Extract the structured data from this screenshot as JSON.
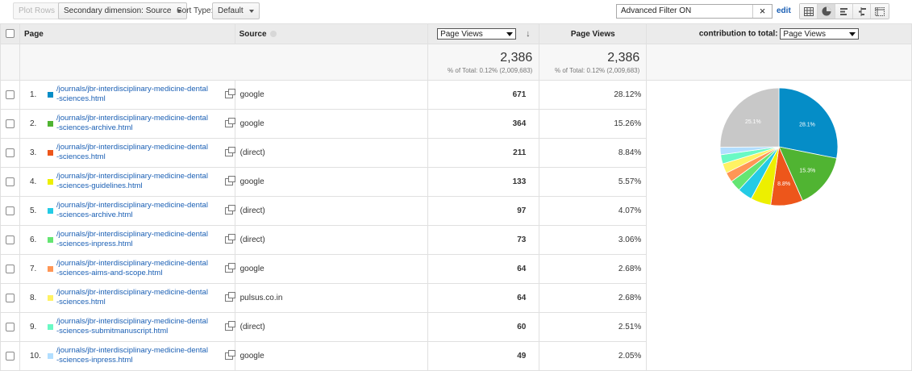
{
  "toolbar": {
    "plot_rows": "Plot Rows",
    "secondary_dimension": "Secondary dimension: Source",
    "sort_type_label": "Sort Type:",
    "sort_type_value": "Default",
    "filter_text": "Advanced Filter ON",
    "filter_clear": "×",
    "edit": "edit",
    "views": [
      "table-view-icon",
      "pie-view-icon",
      "performance-view-icon",
      "comparison-view-icon",
      "pivot-view-icon"
    ],
    "active_view": "pie-view-icon"
  },
  "columns": {
    "page": "Page",
    "source": "Source",
    "metric_select": "Page Views",
    "page_views": "Page Views",
    "contribution_label": "contribution to total:",
    "contribution_select": "Page Views"
  },
  "summary": {
    "page_views_1": "2,386",
    "page_views_1_sub": "% of Total: 0.12% (2,009,683)",
    "page_views_2": "2,386",
    "page_views_2_sub": "% of Total: 0.12% (2,009,683)"
  },
  "rows": [
    {
      "idx": "1.",
      "color": "#058dc7",
      "page_l1": "/journals/jbr-interdisciplinary-medicine-dental",
      "page_l2": "-sciences.html",
      "source": "google",
      "views": "671",
      "pct": "28.12%"
    },
    {
      "idx": "2.",
      "color": "#50b432",
      "page_l1": "/journals/jbr-interdisciplinary-medicine-dental",
      "page_l2": "-sciences-archive.html",
      "source": "google",
      "views": "364",
      "pct": "15.26%"
    },
    {
      "idx": "3.",
      "color": "#ed561b",
      "page_l1": "/journals/jbr-interdisciplinary-medicine-dental",
      "page_l2": "-sciences.html",
      "source": "(direct)",
      "views": "211",
      "pct": "8.84%"
    },
    {
      "idx": "4.",
      "color": "#edef00",
      "page_l1": "/journals/jbr-interdisciplinary-medicine-dental",
      "page_l2": "-sciences-guidelines.html",
      "source": "google",
      "views": "133",
      "pct": "5.57%"
    },
    {
      "idx": "5.",
      "color": "#24cbe5",
      "page_l1": "/journals/jbr-interdisciplinary-medicine-dental",
      "page_l2": "-sciences-archive.html",
      "source": "(direct)",
      "views": "97",
      "pct": "4.07%"
    },
    {
      "idx": "6.",
      "color": "#64e572",
      "page_l1": "/journals/jbr-interdisciplinary-medicine-dental",
      "page_l2": "-sciences-inpress.html",
      "source": "(direct)",
      "views": "73",
      "pct": "3.06%"
    },
    {
      "idx": "7.",
      "color": "#ff9655",
      "page_l1": "/journals/jbr-interdisciplinary-medicine-dental",
      "page_l2": "-sciences-aims-and-scope.html",
      "source": "google",
      "views": "64",
      "pct": "2.68%"
    },
    {
      "idx": "8.",
      "color": "#fff263",
      "page_l1": "/journals/jbr-interdisciplinary-medicine-dental",
      "page_l2": "-sciences.html",
      "source": "pulsus.co.in",
      "views": "64",
      "pct": "2.68%"
    },
    {
      "idx": "9.",
      "color": "#6af9c4",
      "page_l1": "/journals/jbr-interdisciplinary-medicine-dental",
      "page_l2": "-sciences-submitmanuscript.html",
      "source": "(direct)",
      "views": "60",
      "pct": "2.51%"
    },
    {
      "idx": "10.",
      "color": "#b2deff",
      "page_l1": "/journals/jbr-interdisciplinary-medicine-dental",
      "page_l2": "-sciences-inpress.html",
      "source": "google",
      "views": "49",
      "pct": "2.05%"
    }
  ],
  "chart_data": {
    "type": "pie",
    "values": [
      28.12,
      15.26,
      8.84,
      5.57,
      4.07,
      3.06,
      2.68,
      2.68,
      2.51,
      2.05,
      25.1
    ],
    "colors": [
      "#058dc7",
      "#50b432",
      "#ed561b",
      "#edef00",
      "#24cbe5",
      "#64e572",
      "#ff9655",
      "#fff263",
      "#6af9c4",
      "#b2deff",
      "#c8c8c8"
    ],
    "slice_labels": [
      "28.1%",
      "15.3%",
      "8.8%",
      "",
      "",
      "",
      "",
      "",
      "",
      "",
      "25.1%"
    ]
  }
}
